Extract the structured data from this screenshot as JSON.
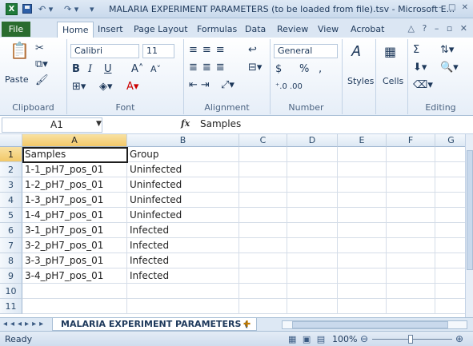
{
  "window": {
    "title": "MALARIA EXPERIMENT PARAMETERS (to be loaded from file).tsv - Microsoft E...",
    "app_icon": "X",
    "controls": "– □ ✕"
  },
  "ribbon_tabs": [
    "File",
    "Home",
    "Insert",
    "Page Layout",
    "Formulas",
    "Data",
    "Review",
    "View",
    "Acrobat"
  ],
  "ribbon": {
    "clipboard": {
      "label": "Clipboard",
      "paste": "Paste"
    },
    "font": {
      "label": "Font",
      "name": "Calibri",
      "size": "11",
      "bold": "B",
      "italic": "I",
      "underline": "U",
      "grow": "A˄",
      "shrink": "A˅"
    },
    "alignment": {
      "label": "Alignment"
    },
    "number": {
      "label": "Number",
      "format": "General",
      "currency": "$",
      "percent": "%",
      "comma": ","
    },
    "styles": {
      "label": "Styles"
    },
    "cells": {
      "label": "Cells"
    },
    "editing": {
      "label": "Editing",
      "sum": "Σ"
    }
  },
  "formula_bar": {
    "name_box": "A1",
    "fx": "fx",
    "value": "Samples"
  },
  "columns": [
    "A",
    "B",
    "C",
    "D",
    "E",
    "F",
    "G"
  ],
  "rows": [
    {
      "num": "1",
      "a": "Samples",
      "b": "Group"
    },
    {
      "num": "2",
      "a": "1-1_pH7_pos_01",
      "b": "Uninfected"
    },
    {
      "num": "3",
      "a": "1-2_pH7_pos_01",
      "b": "Uninfected"
    },
    {
      "num": "4",
      "a": "1-3_pH7_pos_01",
      "b": "Uninfected"
    },
    {
      "num": "5",
      "a": "1-4_pH7_pos_01",
      "b": "Uninfected"
    },
    {
      "num": "6",
      "a": "3-1_pH7_pos_01",
      "b": "Infected"
    },
    {
      "num": "7",
      "a": "3-2_pH7_pos_01",
      "b": "Infected"
    },
    {
      "num": "8",
      "a": "3-3_pH7_pos_01",
      "b": "Infected"
    },
    {
      "num": "9",
      "a": "3-4_pH7_pos_01",
      "b": "Infected"
    },
    {
      "num": "10",
      "a": "",
      "b": ""
    },
    {
      "num": "11",
      "a": "",
      "b": ""
    }
  ],
  "sheet_tab": "MALARIA EXPERIMENT PARAMETERS (",
  "status": {
    "text": "Ready",
    "zoom": "100%"
  }
}
